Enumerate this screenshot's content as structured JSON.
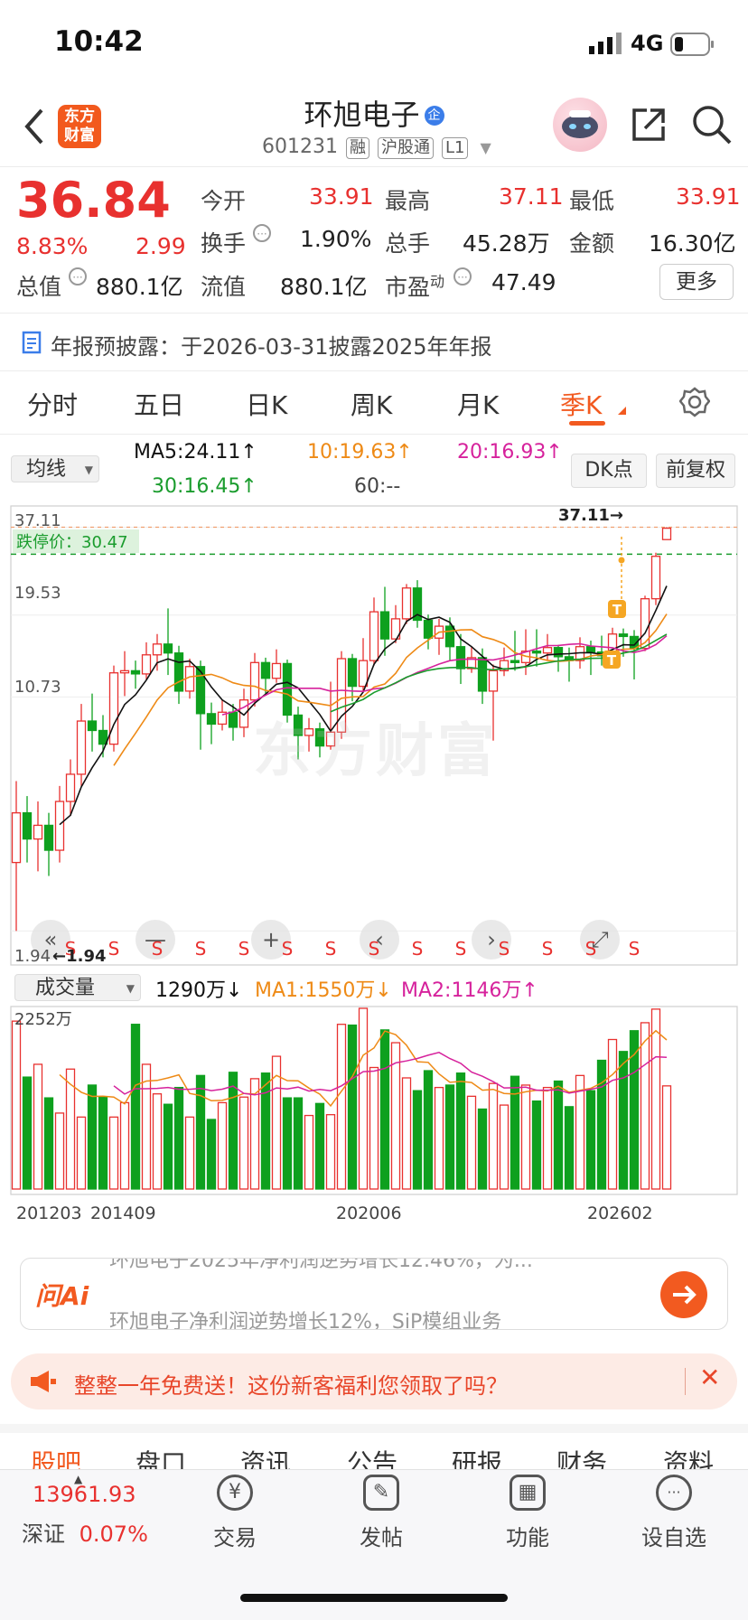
{
  "status_bar": {
    "time": "10:42",
    "network": "4G"
  },
  "header": {
    "name": "环旭电子",
    "enterprise_badge": "企",
    "code": "601231",
    "tags": [
      "融",
      "沪股通",
      "L1"
    ],
    "logo_line1": "东方",
    "logo_line2": "财富"
  },
  "quote": {
    "price": "36.84",
    "change_pct": "8.83%",
    "change_amt": "2.99",
    "open_label": "今开",
    "open": "33.91",
    "high_label": "最高",
    "high": "37.11",
    "low_label": "最低",
    "low": "33.91",
    "turnover_label": "换手",
    "turnover": "1.90%",
    "volume_label": "总手",
    "volume": "45.28万",
    "amount_label": "金额",
    "amount": "16.30亿",
    "mktcap_label": "总值",
    "mktcap": "880.1亿",
    "float_label": "流值",
    "float": "880.1亿",
    "pe_label": "市盈",
    "pe_sup": "动",
    "pe": "47.49",
    "more_label": "更多"
  },
  "notice": {
    "text": "年报预披露：于2026-03-31披露2025年年报"
  },
  "chart_tabs": [
    {
      "label": "分时"
    },
    {
      "label": "五日"
    },
    {
      "label": "日K"
    },
    {
      "label": "周K"
    },
    {
      "label": "月K"
    },
    {
      "label": "季K"
    }
  ],
  "indicators": {
    "ma_select": "均线",
    "ma5": "MA5:24.11↑",
    "ma10": "10:19.63↑",
    "ma20": "20:16.93↑",
    "ma30": "30:16.45↑",
    "ma60": "60:--",
    "dk_label": "DK点",
    "adjust_label": "前复权"
  },
  "kline": {
    "y_labels": [
      "37.11",
      "19.53",
      "10.73",
      "1.94"
    ],
    "stop_price_label": "跌停价：30.47",
    "high_marker": "37.11→",
    "low_marker": "←1.94",
    "watermark": "东方财富"
  },
  "volume": {
    "select": "成交量",
    "vol": "1290万↓",
    "ma1": "MA1:1550万↓",
    "ma2": "MA2:1146万↑",
    "max_label": "2252万",
    "x_labels": [
      "201203",
      "201409",
      "202006",
      "202602"
    ]
  },
  "ai": {
    "logo": "问Ai",
    "line1": "环旭电子2025年净利润逆势增长12.46%，为...",
    "line2": "环旭电子净利润逆势增长12%，SiP模组业务"
  },
  "promo": {
    "text": "整整一年免费送！这份新客福利您领取了吗？"
  },
  "bottom_tabs": [
    {
      "label": "股吧"
    },
    {
      "label": "盘口"
    },
    {
      "label": "资讯"
    },
    {
      "label": "公告"
    },
    {
      "label": "研报"
    },
    {
      "label": "财务"
    },
    {
      "label": "资料"
    }
  ],
  "index": {
    "value": "13961.93",
    "name": "深证",
    "change": "0.07%"
  },
  "nav": [
    {
      "label": "交易",
      "icon": "¥"
    },
    {
      "label": "发帖",
      "icon": "✎"
    },
    {
      "label": "功能",
      "icon": "▦"
    },
    {
      "label": "设自选",
      "icon": "···"
    }
  ],
  "chart_data": {
    "type": "candlestick",
    "period": "quarterly",
    "x_ticks": [
      "201203",
      "201409",
      "202006",
      "202602"
    ],
    "y_ticks": [
      37.11,
      19.53,
      10.73,
      1.94
    ],
    "price_high": 37.11,
    "price_low": 1.94,
    "last_close": 36.84,
    "stop_price": 30.47,
    "candles": [
      [
        3.2,
        4.6,
        1.94,
        5.8
      ],
      [
        4.6,
        3.8,
        3.2,
        5.2
      ],
      [
        3.8,
        4.2,
        3.0,
        5.0
      ],
      [
        4.2,
        3.5,
        2.9,
        4.6
      ],
      [
        3.5,
        5.0,
        3.2,
        5.6
      ],
      [
        5.0,
        6.1,
        4.5,
        6.8
      ],
      [
        6.1,
        9.0,
        5.6,
        10.2
      ],
      [
        9.0,
        8.4,
        7.2,
        11.0
      ],
      [
        8.4,
        7.6,
        6.9,
        9.4
      ],
      [
        7.6,
        12.8,
        7.2,
        13.5
      ],
      [
        12.8,
        13.0,
        10.8,
        15.0
      ],
      [
        13.0,
        12.7,
        11.4,
        14.0
      ],
      [
        12.7,
        14.6,
        12.2,
        16.0
      ],
      [
        14.6,
        15.8,
        13.0,
        17.0
      ],
      [
        15.8,
        14.8,
        12.6,
        20.5
      ],
      [
        14.8,
        11.2,
        10.2,
        15.6
      ],
      [
        11.2,
        13.4,
        10.6,
        14.2
      ],
      [
        13.4,
        9.5,
        7.3,
        14.0
      ],
      [
        9.5,
        8.8,
        7.6,
        10.3
      ],
      [
        8.8,
        9.6,
        8.4,
        10.5
      ],
      [
        9.6,
        8.6,
        7.8,
        10.2
      ],
      [
        8.6,
        10.5,
        8.0,
        11.4
      ],
      [
        10.5,
        13.8,
        10.0,
        14.8
      ],
      [
        13.8,
        12.3,
        11.0,
        14.3
      ],
      [
        12.3,
        13.7,
        11.9,
        15.2
      ],
      [
        13.7,
        9.4,
        8.9,
        14.1
      ],
      [
        9.4,
        8.1,
        6.8,
        10.0
      ],
      [
        8.1,
        8.5,
        7.2,
        9.2
      ],
      [
        8.5,
        7.5,
        6.9,
        8.9
      ],
      [
        7.5,
        8.3,
        7.3,
        12.0
      ],
      [
        8.3,
        14.2,
        7.9,
        15.0
      ],
      [
        14.2,
        11.6,
        10.4,
        14.7
      ],
      [
        11.6,
        14.0,
        11.2,
        16.5
      ],
      [
        14.0,
        20.0,
        13.5,
        22.2
      ],
      [
        20.0,
        16.4,
        14.5,
        24.0
      ],
      [
        16.4,
        19.0,
        15.9,
        21.0
      ],
      [
        19.0,
        23.8,
        18.3,
        24.5
      ],
      [
        23.8,
        18.8,
        17.8,
        25.2
      ],
      [
        18.8,
        16.5,
        15.2,
        19.6
      ],
      [
        16.5,
        18.0,
        14.6,
        19.0
      ],
      [
        18.0,
        15.5,
        14.0,
        19.2
      ],
      [
        15.5,
        13.2,
        11.8,
        17.0
      ],
      [
        13.2,
        14.3,
        12.8,
        15.5
      ],
      [
        14.3,
        11.2,
        10.2,
        15.3
      ],
      [
        11.2,
        13.0,
        7.8,
        13.6
      ],
      [
        13.0,
        14.0,
        12.5,
        15.4
      ],
      [
        14.0,
        13.8,
        13.0,
        17.4
      ],
      [
        13.8,
        15.0,
        12.6,
        17.6
      ],
      [
        15.0,
        14.8,
        13.4,
        17.6
      ],
      [
        14.8,
        15.4,
        14.0,
        17.0
      ],
      [
        15.4,
        14.4,
        12.9,
        15.7
      ],
      [
        14.4,
        14.0,
        12.0,
        15.4
      ],
      [
        14.0,
        15.5,
        13.2,
        16.6
      ],
      [
        15.5,
        14.9,
        12.6,
        16.2
      ],
      [
        14.9,
        14.5,
        13.5,
        16.8
      ],
      [
        14.5,
        17.0,
        14.0,
        17.8
      ],
      [
        17.0,
        16.7,
        14.4,
        17.7
      ],
      [
        16.7,
        15.3,
        12.2,
        17.5
      ],
      [
        15.3,
        22.0,
        15.0,
        22.5
      ],
      [
        22.0,
        30.0,
        21.0,
        30.8
      ],
      [
        33.9,
        36.84,
        33.9,
        37.11
      ]
    ],
    "volumes": [
      2100,
      1400,
      1560,
      1140,
      950,
      1500,
      900,
      1300,
      1150,
      900,
      1080,
      2060,
      1560,
      1190,
      1060,
      1270,
      900,
      1420,
      870,
      1080,
      1460,
      1150,
      1380,
      1450,
      1660,
      1140,
      1140,
      920,
      1070,
      930,
      2060,
      2050,
      2260,
      1520,
      1990,
      1830,
      1390,
      1230,
      1480,
      1270,
      1300,
      1450,
      1160,
      1000,
      1320,
      1050,
      1410,
      1300,
      1100,
      1270,
      1350,
      1030,
      1420,
      1230,
      1610,
      1870,
      1720,
      1980,
      2080,
      2250,
      1290
    ]
  }
}
